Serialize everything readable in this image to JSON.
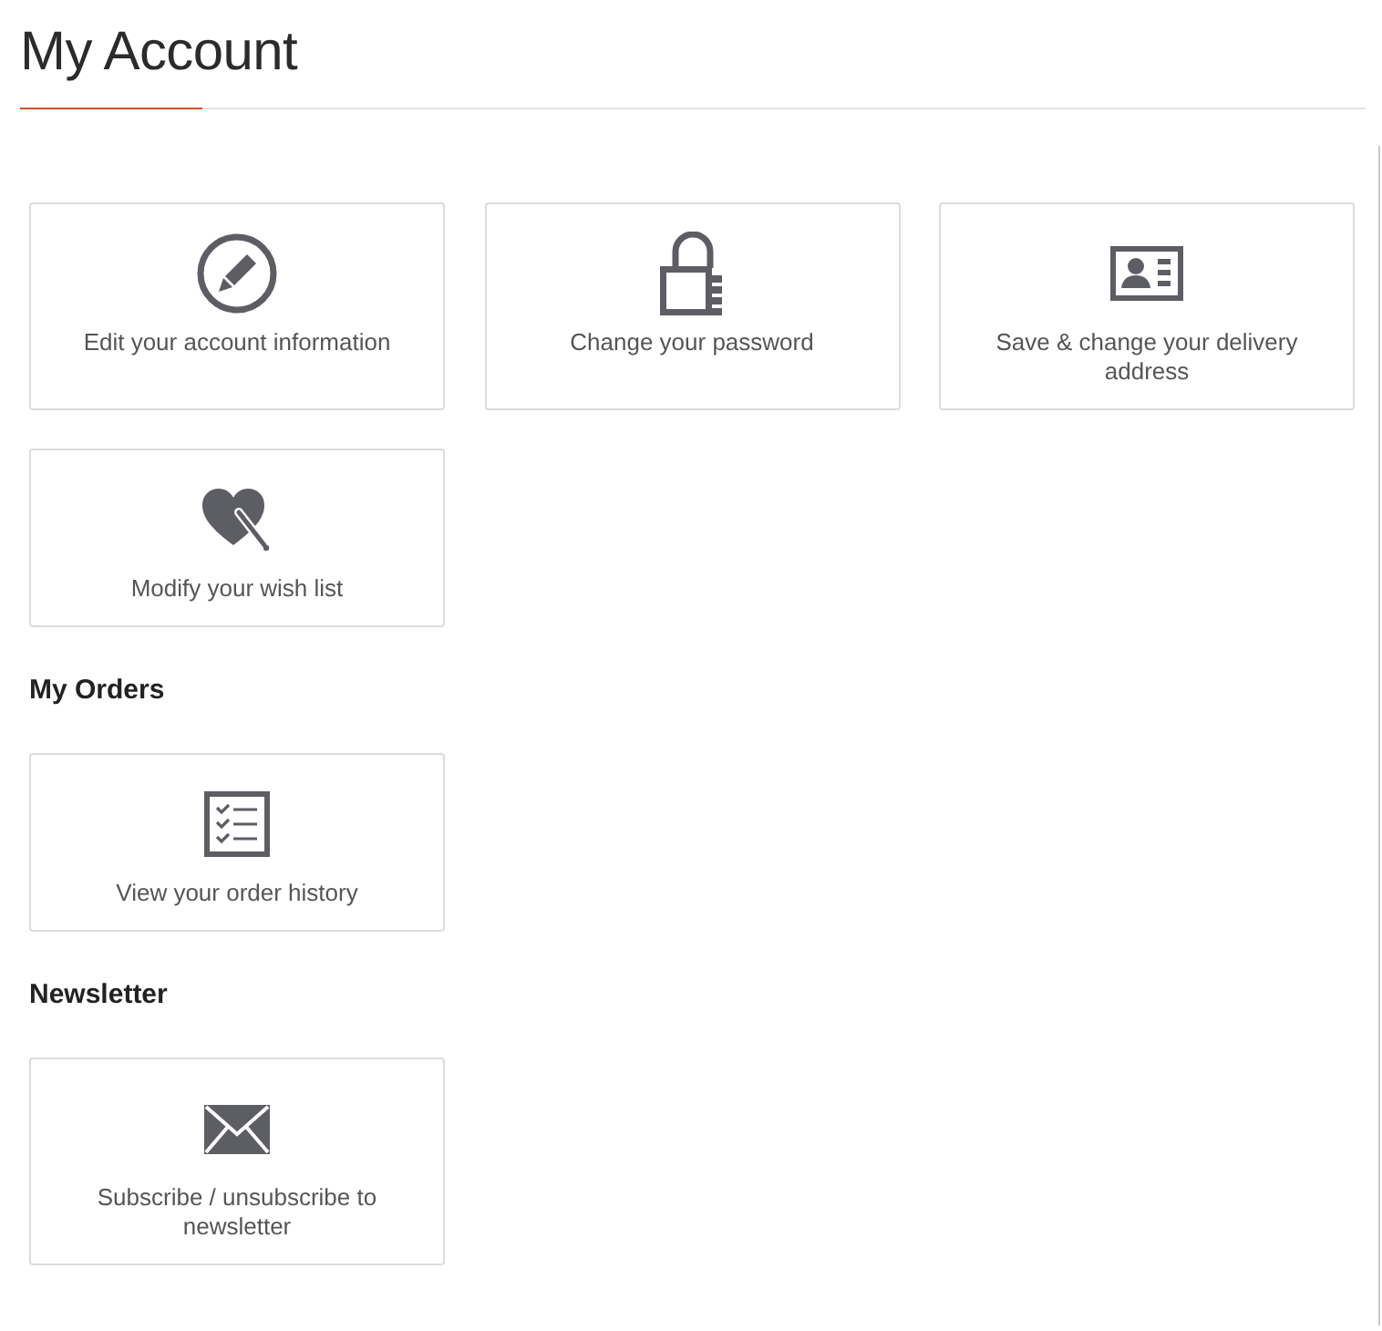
{
  "page": {
    "title": "My Account"
  },
  "sections": [
    {
      "items": [
        {
          "kind": "edit",
          "label": "Edit your account information"
        },
        {
          "kind": "password",
          "label": "Change your password"
        },
        {
          "kind": "address",
          "label": "Save & change your delivery address"
        },
        {
          "kind": "wishlist",
          "label": "Modify your wish list"
        }
      ]
    },
    {
      "heading": "My Orders",
      "items": [
        {
          "kind": "orders",
          "label": "View your order history"
        }
      ]
    },
    {
      "heading": "Newsletter",
      "items": [
        {
          "kind": "newsletter",
          "label": "Subscribe / unsubscribe to newsletter"
        }
      ]
    }
  ]
}
